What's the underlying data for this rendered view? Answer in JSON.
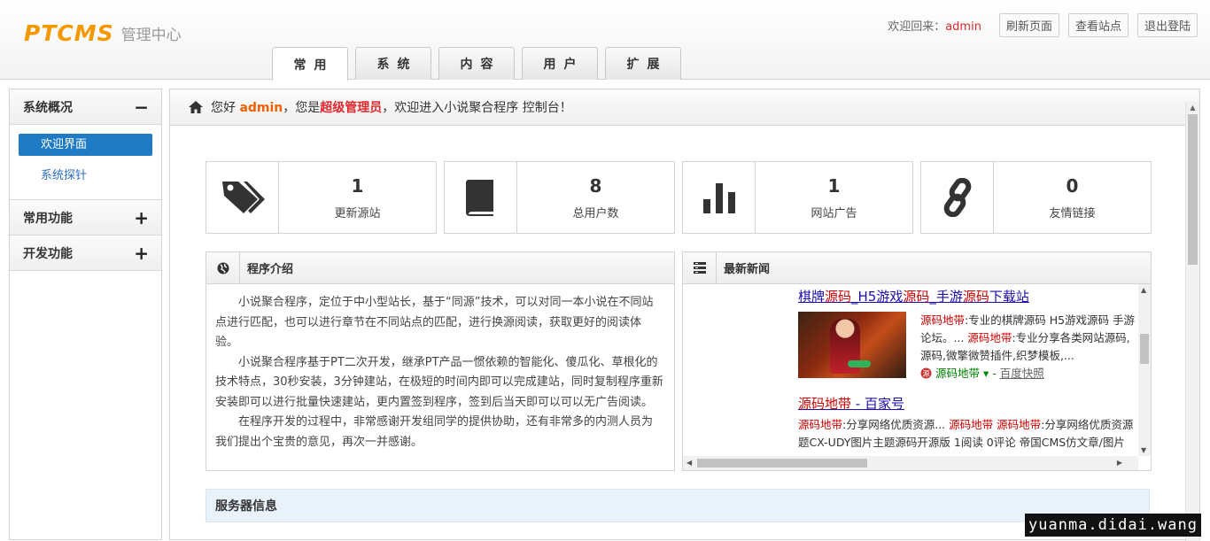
{
  "header": {
    "logo_mark": "PTCMS",
    "logo_sub": "管理中心",
    "welcome_prefix": "欢迎回来：",
    "username": "admin",
    "buttons": [
      "刷新页面",
      "查看站点",
      "退出登陆"
    ]
  },
  "nav": {
    "tabs": [
      "常用",
      "系统",
      "内容",
      "用户",
      "扩展"
    ]
  },
  "sidebar": {
    "groups": [
      {
        "title": "系统概况",
        "toggle": "−",
        "items": [
          "欢迎界面",
          "系统探针"
        ]
      },
      {
        "title": "常用功能",
        "toggle": "+"
      },
      {
        "title": "开发功能",
        "toggle": "+"
      }
    ]
  },
  "main": {
    "greet_1": "您好 ",
    "greet_user": "admin",
    "greet_2": "，您是",
    "greet_role": "超级管理员",
    "greet_3": "，欢迎进入小说聚合程序 控制台！",
    "stats": [
      {
        "value": "1",
        "label": "更新源站",
        "icon": "tags-icon"
      },
      {
        "value": "8",
        "label": "总用户数",
        "icon": "book-icon"
      },
      {
        "value": "1",
        "label": "网站广告",
        "icon": "bar-chart-icon"
      },
      {
        "value": "0",
        "label": "友情链接",
        "icon": "link-icon"
      }
    ],
    "intro": {
      "title": "程序介绍",
      "paragraphs": [
        "小说聚合程序，定位于中小型站长，基于“同源”技术，可以对同一本小说在不同站点进行匹配，也可以进行章节在不同站点的匹配，进行换源阅读，获取更好的阅读体验。",
        "小说聚合程序基于PT二次开发，继承PT产品一惯依赖的智能化、傻瓜化、草根化的技术特点，30秒安装，3分钟建站，在极短的时间内即可以完成建站，同时复制程序重新安装即可以进行批量快速建站，更内置签到程序，签到后当天即可以可以无广告阅读。",
        "在程序开发的过程中，非常感谢开发组同学的提供协助，还有非常多的内测人员为我们提出个宝贵的意见，再次一并感谢。"
      ]
    },
    "news": {
      "title": "最新新闻",
      "item1_title_parts": [
        "棋牌",
        "源码",
        "_H5游戏",
        "源码",
        "_手游",
        "源码",
        "下载站"
      ],
      "item1_lines": [
        [
          "源码地带",
          ":专业的棋牌源码 H5游戏源码 手游"
        ],
        [
          "论坛。... ",
          "源码地带",
          ":专业分享各类网站源码,"
        ],
        [
          "",
          "源码,微擎微赞插件,织梦模板,..."
        ]
      ],
      "item1_source": "源码地带",
      "item1_snapshot": "百度快照",
      "item2_title_parts": [
        "源码地带",
        " - 百家号"
      ],
      "item2_line1": [
        "源码地带",
        ":分享网络优质资源... ",
        "源码地带",
        " ",
        "源码地带",
        ":分享网络优质资源"
      ],
      "item2_line2": "题CX-UDY图片主题源码开源版 1阅读 0评论 帝国CMS仿文章/图片"
    },
    "server_title": "服务器信息"
  },
  "watermark": "yuanma.didai.wang"
}
